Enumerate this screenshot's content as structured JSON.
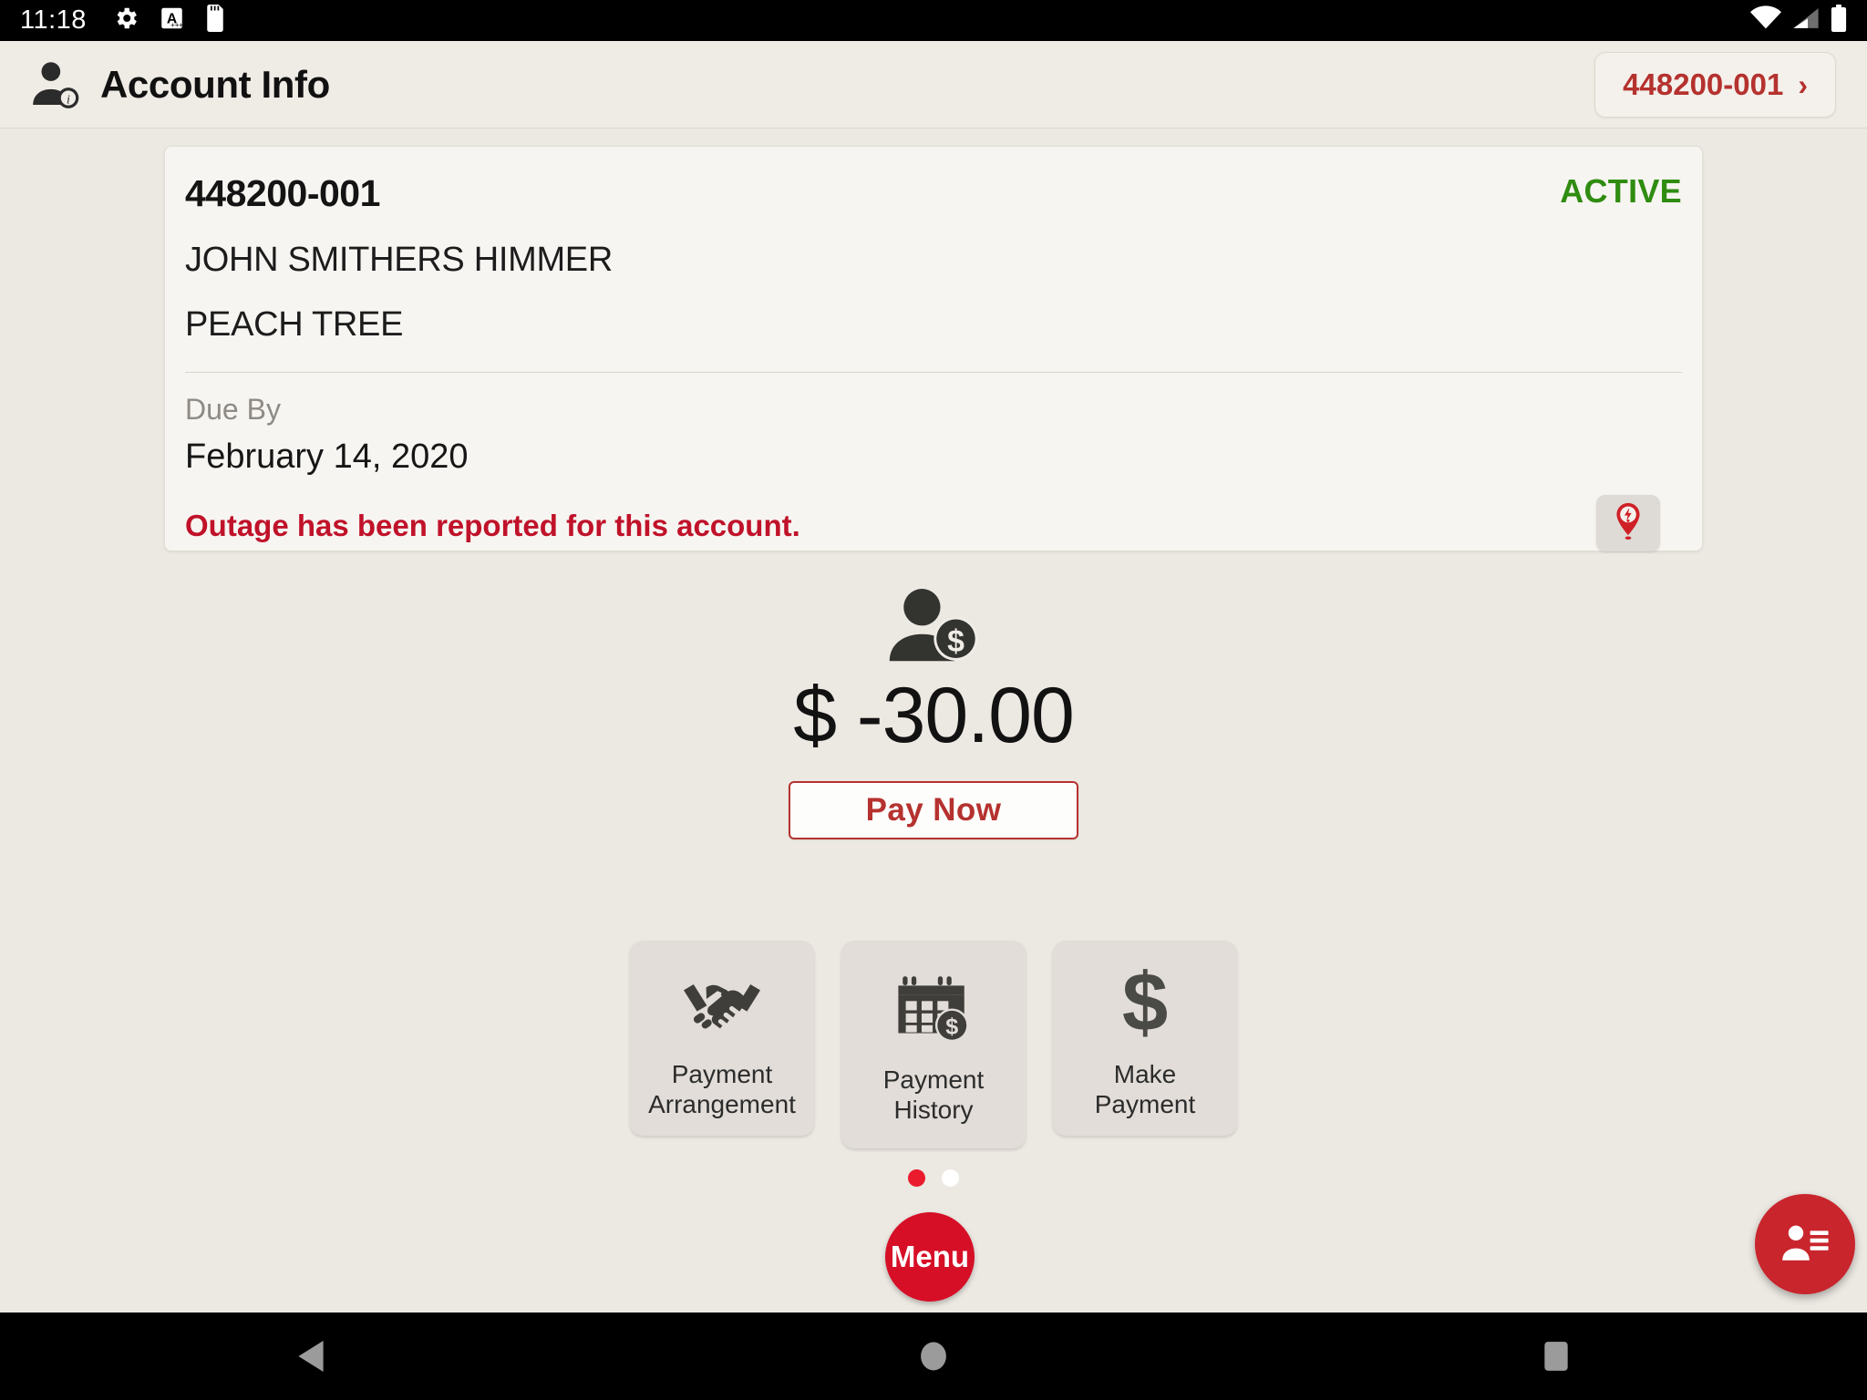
{
  "statusbar": {
    "clock": "11:18",
    "left_icons": [
      "gear-icon",
      "font-size-a-icon",
      "sd-card-icon"
    ],
    "right_icons": [
      "wifi-icon",
      "cellular-signal-icon",
      "battery-icon"
    ]
  },
  "header": {
    "icon": "account-info-person-icon",
    "title": "Account Info",
    "account_chip": {
      "label": "448200-001",
      "chevron": "›"
    }
  },
  "account_card": {
    "account_number": "448200-001",
    "status": "ACTIVE",
    "customer_name": "JOHN SMITHERS HIMMER",
    "address": "PEACH TREE",
    "due_label": "Due By",
    "due_date": "February 14, 2020",
    "outage_message": "Outage has been reported for this account.",
    "outage_icon": "outage-pin-icon"
  },
  "balance": {
    "icon": "customer-balance-icon",
    "amount": "$ -30.00",
    "pay_now_label": "Pay Now"
  },
  "tiles": [
    {
      "icon": "handshake-dollar-icon",
      "line1": "Payment",
      "line2": "Arrangement"
    },
    {
      "icon": "calendar-dollar-icon",
      "line1": "Payment",
      "line2": "History"
    },
    {
      "icon": "dollar-sign-icon",
      "line1": "Make Payment",
      "line2": ""
    }
  ],
  "pagination": {
    "total": 2,
    "active_index": 0
  },
  "menu_fab": {
    "label": "Menu"
  },
  "contacts_fab": {
    "icon": "contact-card-icon"
  },
  "navbar": {
    "back": "back-triangle-icon",
    "home": "home-circle-icon",
    "recents": "recents-square-icon"
  },
  "colors": {
    "brand_red": "#c9252d",
    "accent_red": "#b5322f",
    "menu_red": "#d60f27",
    "dot_red": "#ea1b2d",
    "active_green": "#2f8c11",
    "outage_red": "#c0122a",
    "page_bg": "#ece8e2",
    "card_bg": "#f7f5f1",
    "tile_bg": "#e2ddd8"
  }
}
